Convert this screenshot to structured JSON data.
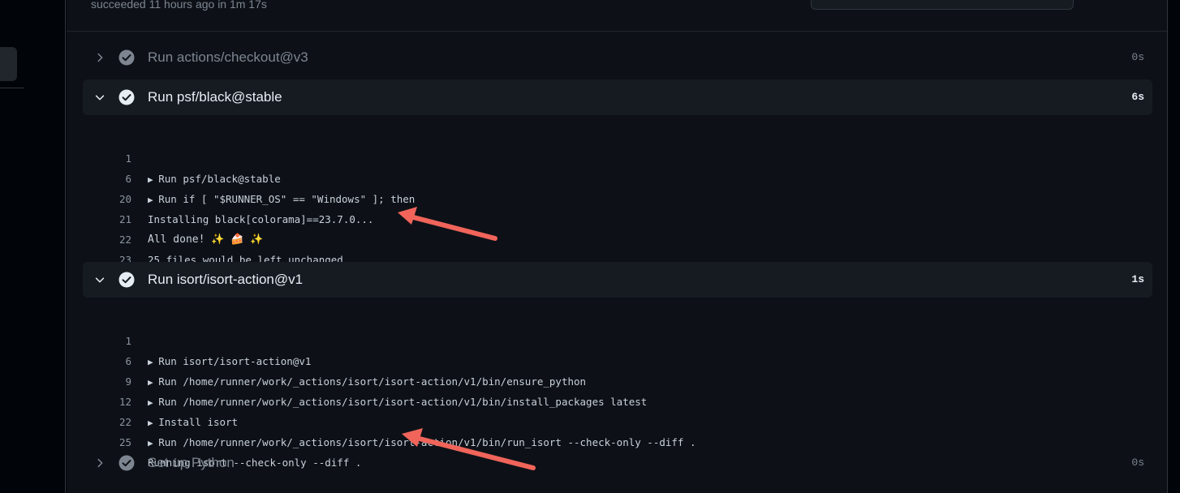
{
  "header": {
    "status": "succeeded 11 hours ago in 1m 17s"
  },
  "colors": {
    "accent_arrow": "#f0645a",
    "background": "#0d1117",
    "panel": "#161b22"
  },
  "steps": [
    {
      "title": "Run actions/checkout@v3",
      "duration": "0s",
      "expanded": false,
      "icon": "check-circle-icon"
    },
    {
      "title": "Run psf/black@stable",
      "duration": "6s",
      "expanded": true,
      "icon": "check-circle-icon",
      "lines": [
        {
          "n": "1",
          "text": "Run psf/black@stable",
          "group": true
        },
        {
          "n": "6",
          "text": "Run if [ \"$RUNNER_OS\" == \"Windows\" ]; then",
          "group": true
        },
        {
          "n": "20",
          "text": "Installing black[colorama]==23.7.0...",
          "group": false
        },
        {
          "n": "21",
          "text": "All done! ✨ 🍰 ✨",
          "group": false
        },
        {
          "n": "22",
          "text": "25 files would be left unchanged.",
          "group": false
        },
        {
          "n": "23",
          "text": "",
          "group": false
        }
      ]
    },
    {
      "title": "Run isort/isort-action@v1",
      "duration": "1s",
      "expanded": true,
      "icon": "check-circle-icon",
      "lines": [
        {
          "n": "1",
          "text": "Run isort/isort-action@v1",
          "group": true
        },
        {
          "n": "6",
          "text": "Run /home/runner/work/_actions/isort/isort-action/v1/bin/ensure_python",
          "group": true
        },
        {
          "n": "9",
          "text": "Run /home/runner/work/_actions/isort/isort-action/v1/bin/install_packages latest",
          "group": true
        },
        {
          "n": "12",
          "text": "Install isort",
          "group": true
        },
        {
          "n": "22",
          "text": "Run /home/runner/work/_actions/isort/isort-action/v1/bin/run_isort --check-only --diff .",
          "group": true
        },
        {
          "n": "25",
          "text": "Running isort --check-only --diff .",
          "group": false
        }
      ]
    },
    {
      "title": "Set up Python",
      "duration": "0s",
      "expanded": false,
      "icon": "check-circle-icon"
    }
  ]
}
